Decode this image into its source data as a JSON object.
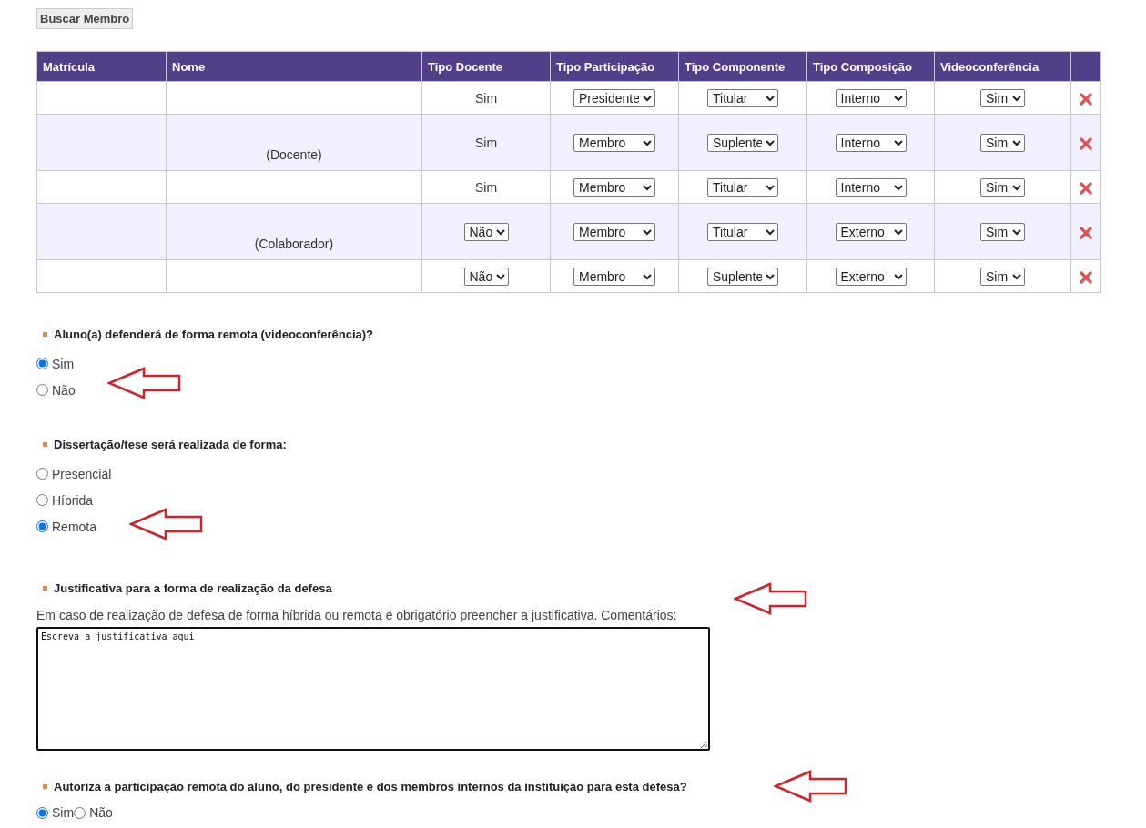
{
  "search_button": "Buscar Membro",
  "table": {
    "columns": [
      "Matrícula",
      "Nome",
      "Tipo Docente",
      "Tipo Participação",
      "Tipo Componente",
      "Tipo Composição",
      "Videoconferência"
    ],
    "rows": [
      {
        "tipo_docente": {
          "kind": "text",
          "value": "Sim"
        },
        "participacao": "Presidente",
        "componente": "Titular",
        "composicao": "Interno",
        "videoconferencia": "Sim"
      },
      {
        "nome_note": "(Docente)",
        "tipo_docente": {
          "kind": "text",
          "value": "Sim"
        },
        "participacao": "Membro",
        "componente": "Suplente",
        "composicao": "Interno",
        "videoconferencia": "Sim"
      },
      {
        "tipo_docente": {
          "kind": "text",
          "value": "Sim"
        },
        "participacao": "Membro",
        "componente": "Titular",
        "composicao": "Interno",
        "videoconferencia": "Sim"
      },
      {
        "nome_note": "(Colaborador)",
        "tipo_docente": {
          "kind": "select",
          "value": "Não"
        },
        "participacao": "Membro",
        "componente": "Titular",
        "composicao": "Externo",
        "videoconferencia": "Sim"
      },
      {
        "tipo_docente": {
          "kind": "select",
          "value": "Não"
        },
        "participacao": "Membro",
        "componente": "Suplente",
        "composicao": "Externo",
        "videoconferencia": "Sim"
      }
    ]
  },
  "sections": [
    {
      "kind": "radio_list",
      "heading": "Aluno(a) defenderá de forma remota (videoconferência)?",
      "options": [
        {
          "label": "Sim",
          "selected": true
        },
        {
          "label": "Não",
          "selected": false
        }
      ]
    },
    {
      "kind": "radio_list",
      "heading": "Dissertação/tese será realizada de forma:",
      "options": [
        {
          "label": "Presencial",
          "selected": false
        },
        {
          "label": "Híbrida",
          "selected": false
        },
        {
          "label": "Remota",
          "selected": true
        }
      ]
    },
    {
      "kind": "textarea",
      "heading": "Justificativa para a forma de realização da defesa",
      "description": "Em caso de realização de defesa de forma híbrida ou remota é obrigatório preencher a justificativa. Comentários:",
      "value": "Escreva a justificativa aqui"
    },
    {
      "kind": "radio_inline",
      "heading": "Autoriza a participação remota do aluno, do presidente e dos membros internos da instituição para esta defesa?",
      "options": [
        {
          "label": "Sim",
          "selected": true
        },
        {
          "label": "Não",
          "selected": false
        }
      ]
    }
  ]
}
